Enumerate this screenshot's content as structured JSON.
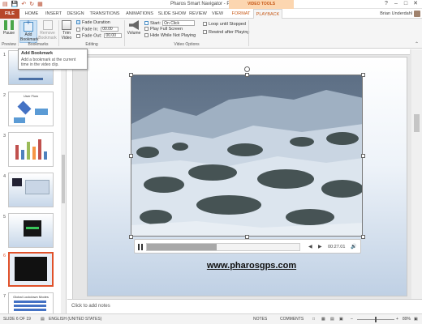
{
  "window": {
    "title": "Pharos Smart Navigator - PowerPoint",
    "controls": [
      "?",
      "–",
      "□",
      "✕"
    ]
  },
  "qat": [
    "save-icon",
    "undo-icon",
    "redo-icon",
    "slideshow-icon"
  ],
  "contextual_header": "VIDEO TOOLS",
  "tabs": [
    "FILE",
    "HOME",
    "INSERT",
    "DESIGN",
    "TRANSITIONS",
    "ANIMATIONS",
    "SLIDE SHOW",
    "REVIEW",
    "VIEW",
    "FORMAT",
    "PLAYBACK"
  ],
  "active_tab": "PLAYBACK",
  "user": "Brian Underdahl",
  "ribbon": {
    "preview": {
      "pause_label": "Pause",
      "group": "Preview"
    },
    "bookmarks": {
      "add_label": "Add Bookmark",
      "remove_label": "Remove Bookmark",
      "group": "Bookmarks"
    },
    "editing": {
      "trim_label": "Trim Video",
      "fade_duration": "Fade Duration",
      "fade_in_label": "Fade In:",
      "fade_in_value": "00.00",
      "fade_out_label": "Fade Out:",
      "fade_out_value": "00.00",
      "group": "Editing"
    },
    "video_options": {
      "volume_label": "Volume",
      "start_label": "Start:",
      "start_value": "On Click",
      "full_screen": "Play Full Screen",
      "hide_not_playing": "Hide While Not Playing",
      "loop": "Loop until Stopped",
      "rewind": "Rewind after Playing",
      "group": "Video Options"
    }
  },
  "tooltip": {
    "title": "Add Bookmark",
    "description": "Add a bookmark at the current time in the video clip."
  },
  "slides": [
    "1",
    "2",
    "3",
    "4",
    "5",
    "6",
    "7"
  ],
  "slide2_title": "User Flow",
  "slide7_title": "Global Lockdown Modes",
  "video": {
    "time": "00:27.01",
    "progress": 0.46
  },
  "website_text": "www.pharosgps.com",
  "notes_placeholder": "Click to add notes",
  "status": {
    "slide": "SLIDE 6 OF 19",
    "language": "ENGLISH (UNITED STATES)",
    "notes": "NOTES",
    "comments": "COMMENTS",
    "zoom": "89%"
  },
  "accent_color": "#b7472a"
}
